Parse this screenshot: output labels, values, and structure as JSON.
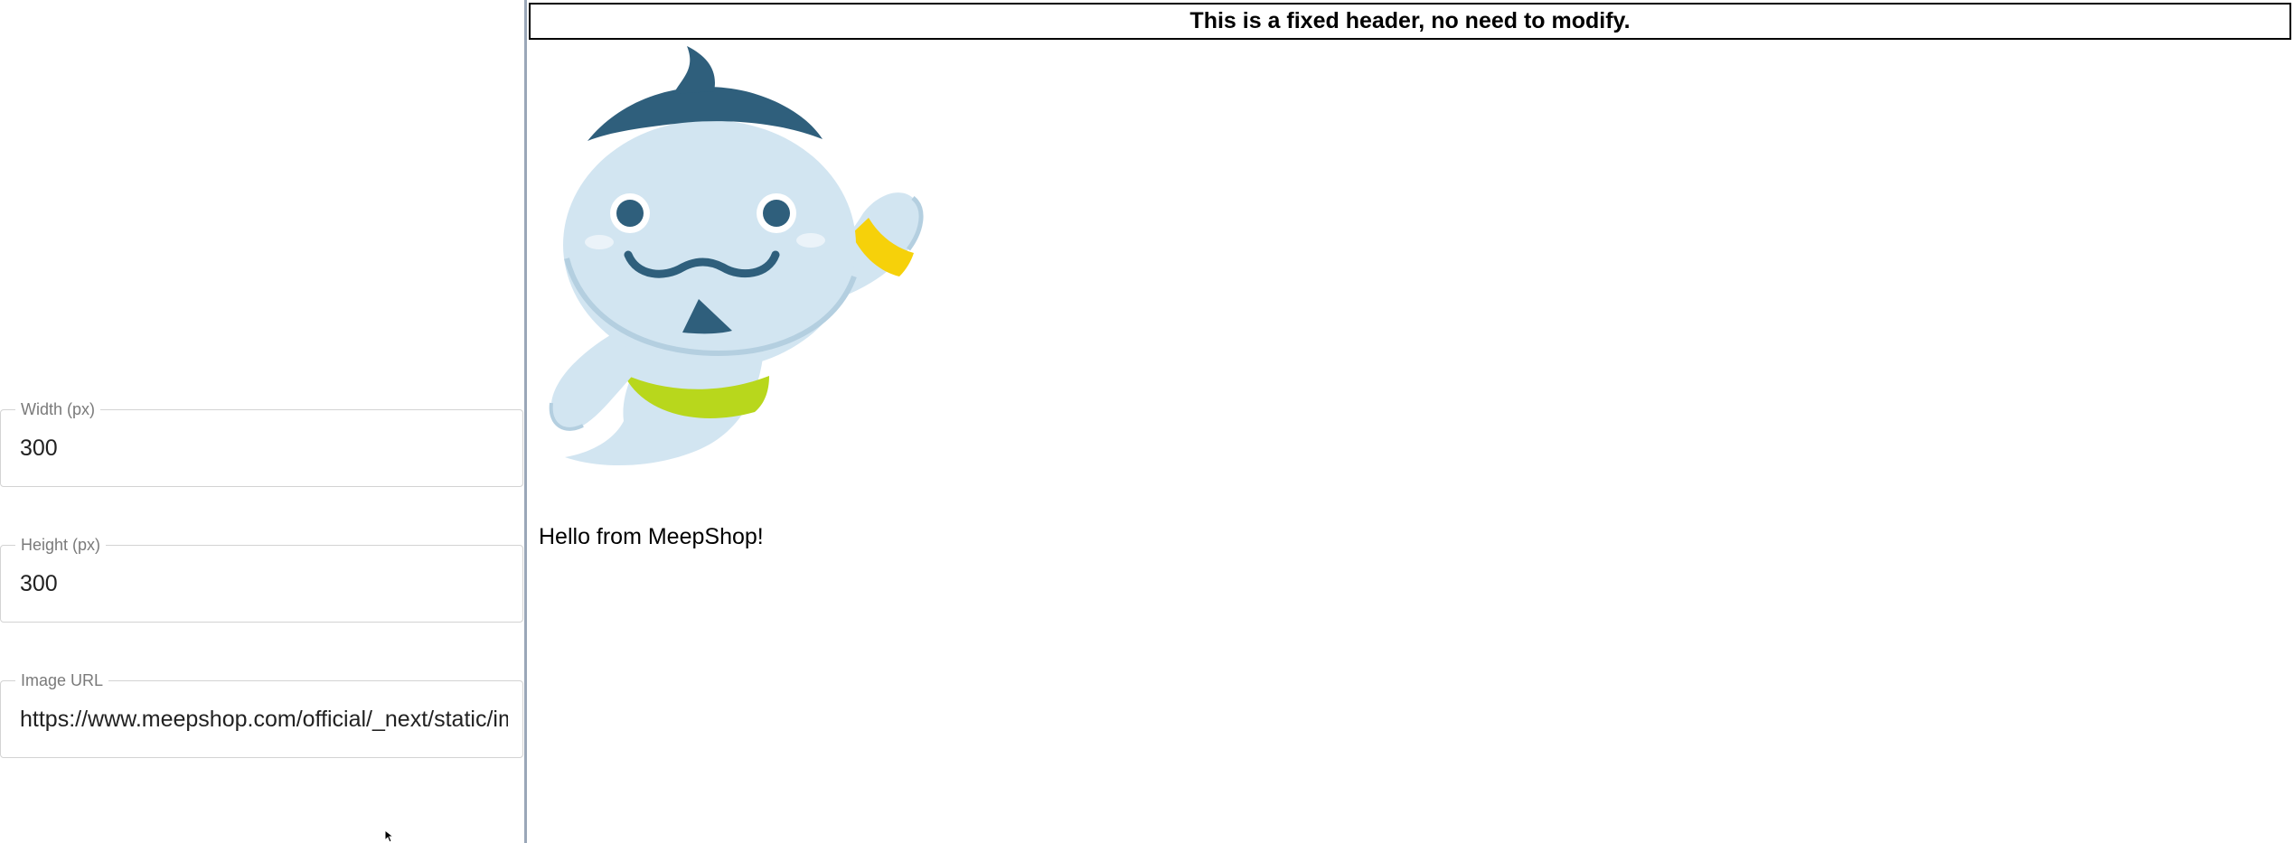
{
  "form": {
    "width": {
      "label": "Width (px)",
      "value": "300"
    },
    "height": {
      "label": "Height (px)",
      "value": "300"
    },
    "image_url": {
      "label": "Image URL",
      "value": "https://www.meepshop.com/official/_next/static/images/meepshop-mascot.png"
    }
  },
  "preview": {
    "header_text": "This is a fixed header, no need to modify.",
    "greeting": "Hello from MeepShop!"
  },
  "colors": {
    "mascot_body": "#d2e5f1",
    "mascot_hair": "#2f5f7c",
    "mascot_shorts": "#b8d71c",
    "mascot_band": "#f6d10a"
  }
}
